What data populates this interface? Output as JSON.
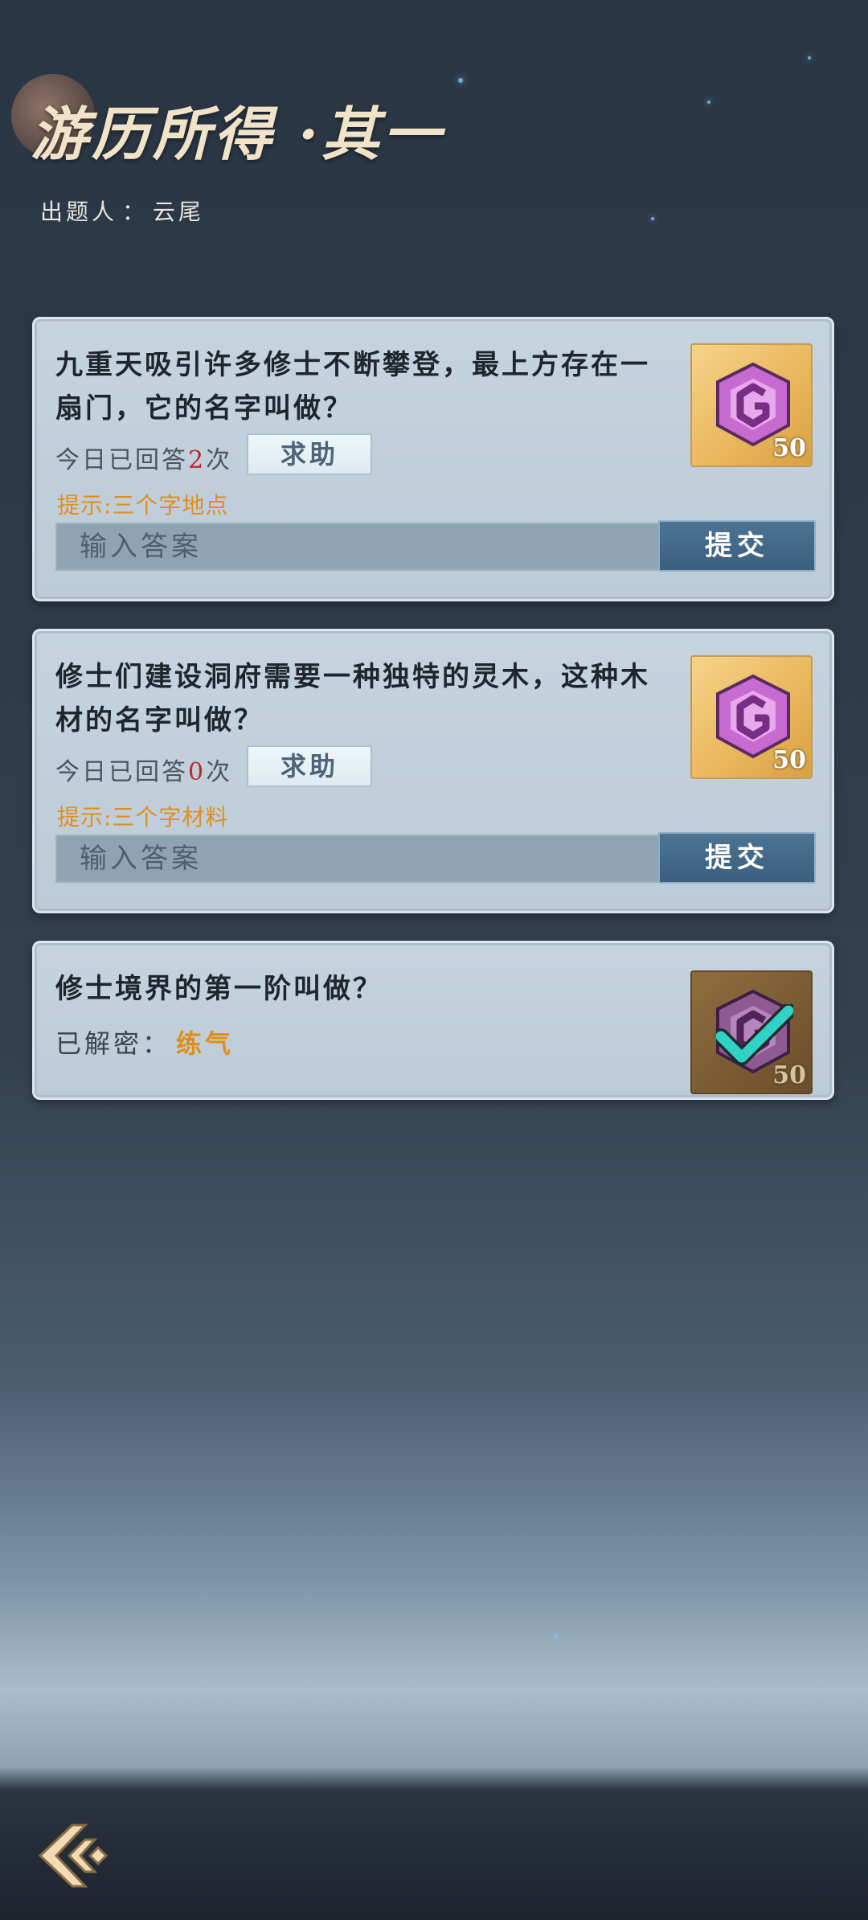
{
  "header": {
    "title": "游历所得 ·其一",
    "author_label": "出题人",
    "author_sep": "：",
    "author_name": "云尾"
  },
  "common": {
    "count_prefix": "今日已回答",
    "count_suffix": "次",
    "help_label": "求助",
    "answer_placeholder": "输入答案",
    "submit_label": "提交",
    "solved_label": "已解密："
  },
  "questions": [
    {
      "text": "九重天吸引许多修士不断攀登，最上方存在一扇门，它的名字叫做？",
      "answered_count": "2",
      "hint": "提示:三个字地点",
      "reward_amount": "50"
    },
    {
      "text": "修士们建设洞府需要一种独特的灵木，这种木材的名字叫做？",
      "answered_count": "0",
      "hint": "提示:三个字材料",
      "reward_amount": "50"
    },
    {
      "text": "修士境界的第一阶叫做？",
      "solved_answer": "练气",
      "reward_amount": "50",
      "completed": true
    }
  ],
  "icons": {
    "reward": "purple-gem-icon",
    "completed": "checkmark-icon",
    "back": "back-arrow-icon"
  },
  "colors": {
    "hint": "#e0901a",
    "count_number": "#c0282a",
    "submit_button": "#3b5f7e",
    "card_background": "#c5d4df"
  }
}
